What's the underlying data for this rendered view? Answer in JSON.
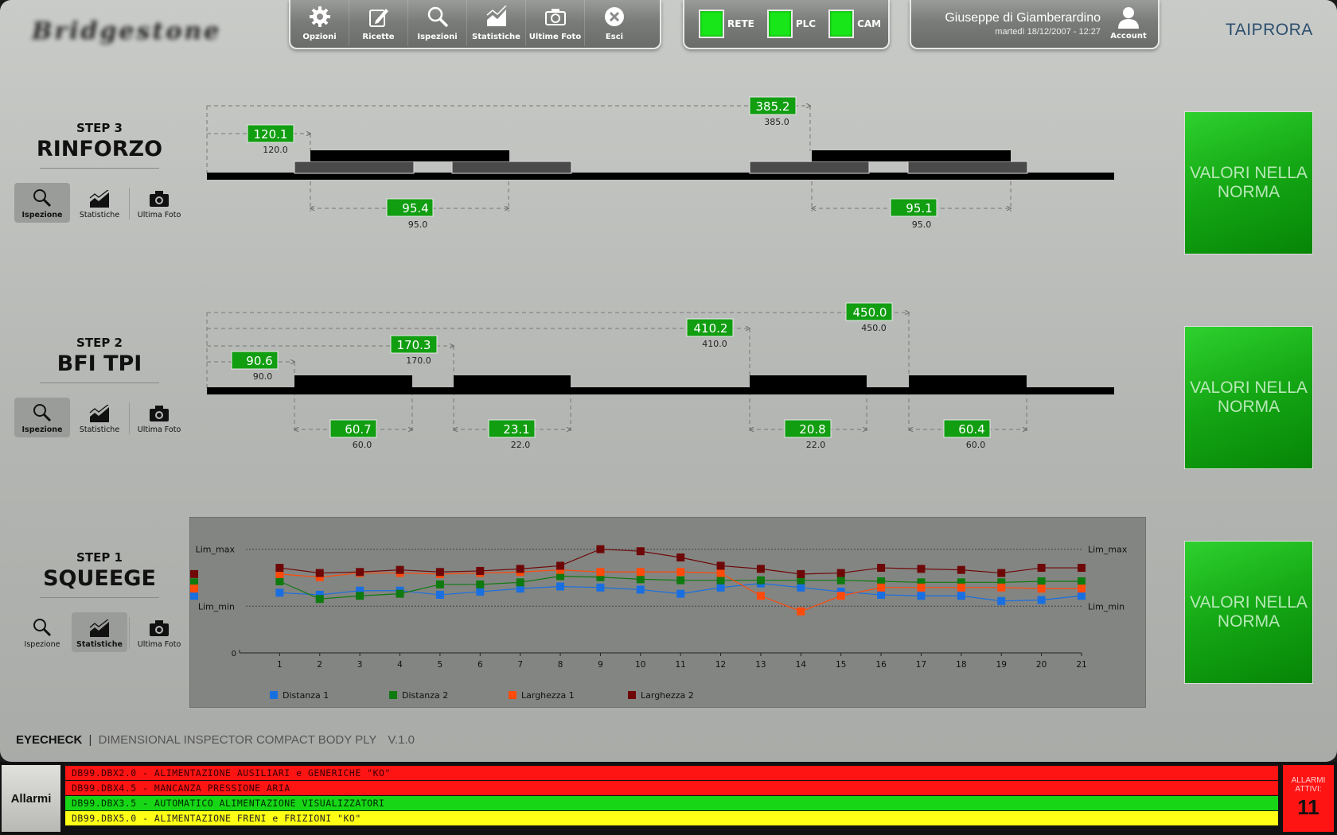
{
  "header": {
    "logo_text": "Bridgestone",
    "toolbar": [
      {
        "label": "Opzioni",
        "icon": "gear-icon"
      },
      {
        "label": "Ricette",
        "icon": "edit-icon"
      },
      {
        "label": "Ispezioni",
        "icon": "search-icon"
      },
      {
        "label": "Statistiche",
        "icon": "chart-icon"
      },
      {
        "label": "Ultime Foto",
        "icon": "camera-icon"
      },
      {
        "label": "Esci",
        "icon": "close-icon"
      }
    ],
    "status": [
      {
        "label": "RETE",
        "color": "#19e619"
      },
      {
        "label": "PLC",
        "color": "#19e619"
      },
      {
        "label": "CAM",
        "color": "#19e619"
      }
    ],
    "user_name": "Giuseppe di Giamberardino",
    "date_time": "martedì 18/12/2007 - 12:27",
    "account_label": "Account",
    "brand": "TAIPRORA"
  },
  "step_buttons": {
    "inspect": "Ispezione",
    "stats": "Statistiche",
    "photo": "Ultima Foto"
  },
  "steps": [
    {
      "number": "STEP 3",
      "title": "RINFORZO",
      "status": "VALORI NELLA NORMA",
      "active_button": "inspect",
      "top_measures": [
        {
          "value": "120.1",
          "nominal": "120.0"
        },
        {
          "value": "385.2",
          "nominal": "385.0"
        }
      ],
      "bottom_measures": [
        {
          "value": "95.4",
          "nominal": "95.0"
        },
        {
          "value": "95.1",
          "nominal": "95.0"
        }
      ]
    },
    {
      "number": "STEP 2",
      "title": "BFI TPI",
      "status": "VALORI NELLA NORMA",
      "active_button": "inspect",
      "top_measures": [
        {
          "value": "90.6",
          "nominal": "90.0"
        },
        {
          "value": "170.3",
          "nominal": "170.0"
        },
        {
          "value": "410.2",
          "nominal": "410.0"
        },
        {
          "value": "450.0",
          "nominal": "450.0"
        }
      ],
      "bottom_measures": [
        {
          "value": "60.7",
          "nominal": "60.0"
        },
        {
          "value": "23.1",
          "nominal": "22.0"
        },
        {
          "value": "20.8",
          "nominal": "22.0"
        },
        {
          "value": "60.4",
          "nominal": "60.0"
        }
      ]
    },
    {
      "number": "STEP 1",
      "title": "SQUEEGE",
      "status": "VALORI NELLA NORMA",
      "active_button": "stats"
    }
  ],
  "chart_data": {
    "type": "line",
    "x": [
      0,
      1,
      2,
      3,
      4,
      5,
      6,
      7,
      8,
      9,
      10,
      11,
      12,
      13,
      14,
      15,
      16,
      17,
      18,
      19,
      20,
      21
    ],
    "y_ticks": [
      "0"
    ],
    "ref_lines": [
      {
        "label": "Lim_max",
        "y": 1.0
      },
      {
        "label": "Lim_min",
        "y": 0.45
      }
    ],
    "ylim": [
      0,
      1.15
    ],
    "series": [
      {
        "name": "Distanza 1",
        "color": "#1a6fe0",
        "values": [
          0.58,
          0.56,
          0.6,
          0.6,
          0.56,
          0.59,
          0.62,
          0.64,
          0.63,
          0.61,
          0.57,
          0.63,
          0.67,
          0.63,
          0.59,
          0.56,
          0.55,
          0.55,
          0.5,
          0.51,
          0.55,
          0.55
        ]
      },
      {
        "name": "Distanza 2",
        "color": "#0f7a0f",
        "values": [
          0.69,
          0.52,
          0.55,
          0.57,
          0.66,
          0.66,
          0.68,
          0.74,
          0.73,
          0.71,
          0.7,
          0.7,
          0.7,
          0.7,
          0.7,
          0.69,
          0.68,
          0.68,
          0.68,
          0.69,
          0.69,
          0.68
        ]
      },
      {
        "name": "Larghezza 1",
        "color": "#ff4a0a",
        "values": [
          0.76,
          0.73,
          0.77,
          0.77,
          0.76,
          0.77,
          0.78,
          0.8,
          0.78,
          0.78,
          0.78,
          0.77,
          0.55,
          0.4,
          0.55,
          0.63,
          0.63,
          0.63,
          0.63,
          0.62,
          0.62,
          0.62
        ]
      },
      {
        "name": "Larghezza 2",
        "color": "#6e0808",
        "values": [
          0.82,
          0.77,
          0.78,
          0.8,
          0.78,
          0.79,
          0.81,
          0.84,
          1.0,
          0.98,
          0.92,
          0.84,
          0.81,
          0.76,
          0.77,
          0.82,
          0.81,
          0.8,
          0.77,
          0.82,
          0.82,
          0.76
        ]
      }
    ]
  },
  "footer": {
    "app": "EYECHECK",
    "sep": "|",
    "description": "DIMENSIONAL INSPECTOR COMPACT BODY PLY",
    "version": "V.1.0"
  },
  "alarms": {
    "button_label": "Allarmi",
    "count_label": "ALLARMI ATTIVI:",
    "count": "11",
    "rows": [
      {
        "text": "DB99.DBX2.0  -  ALIMENTAZIONE AUSILIARI e GENERICHE \"KO\"",
        "level": "red"
      },
      {
        "text": "DB99.DBX4.5  -  MANCANZA PRESSIONE ARIA",
        "level": "red"
      },
      {
        "text": "DB99.DBX3.5  -  AUTOMATICO ALIMENTAZIONE VISUALIZZATORI",
        "level": "green"
      },
      {
        "text": "DB99.DBX5.0  -  ALIMENTAZIONE FRENI e FRIZIONI \"KO\"",
        "level": "yellow"
      }
    ]
  }
}
